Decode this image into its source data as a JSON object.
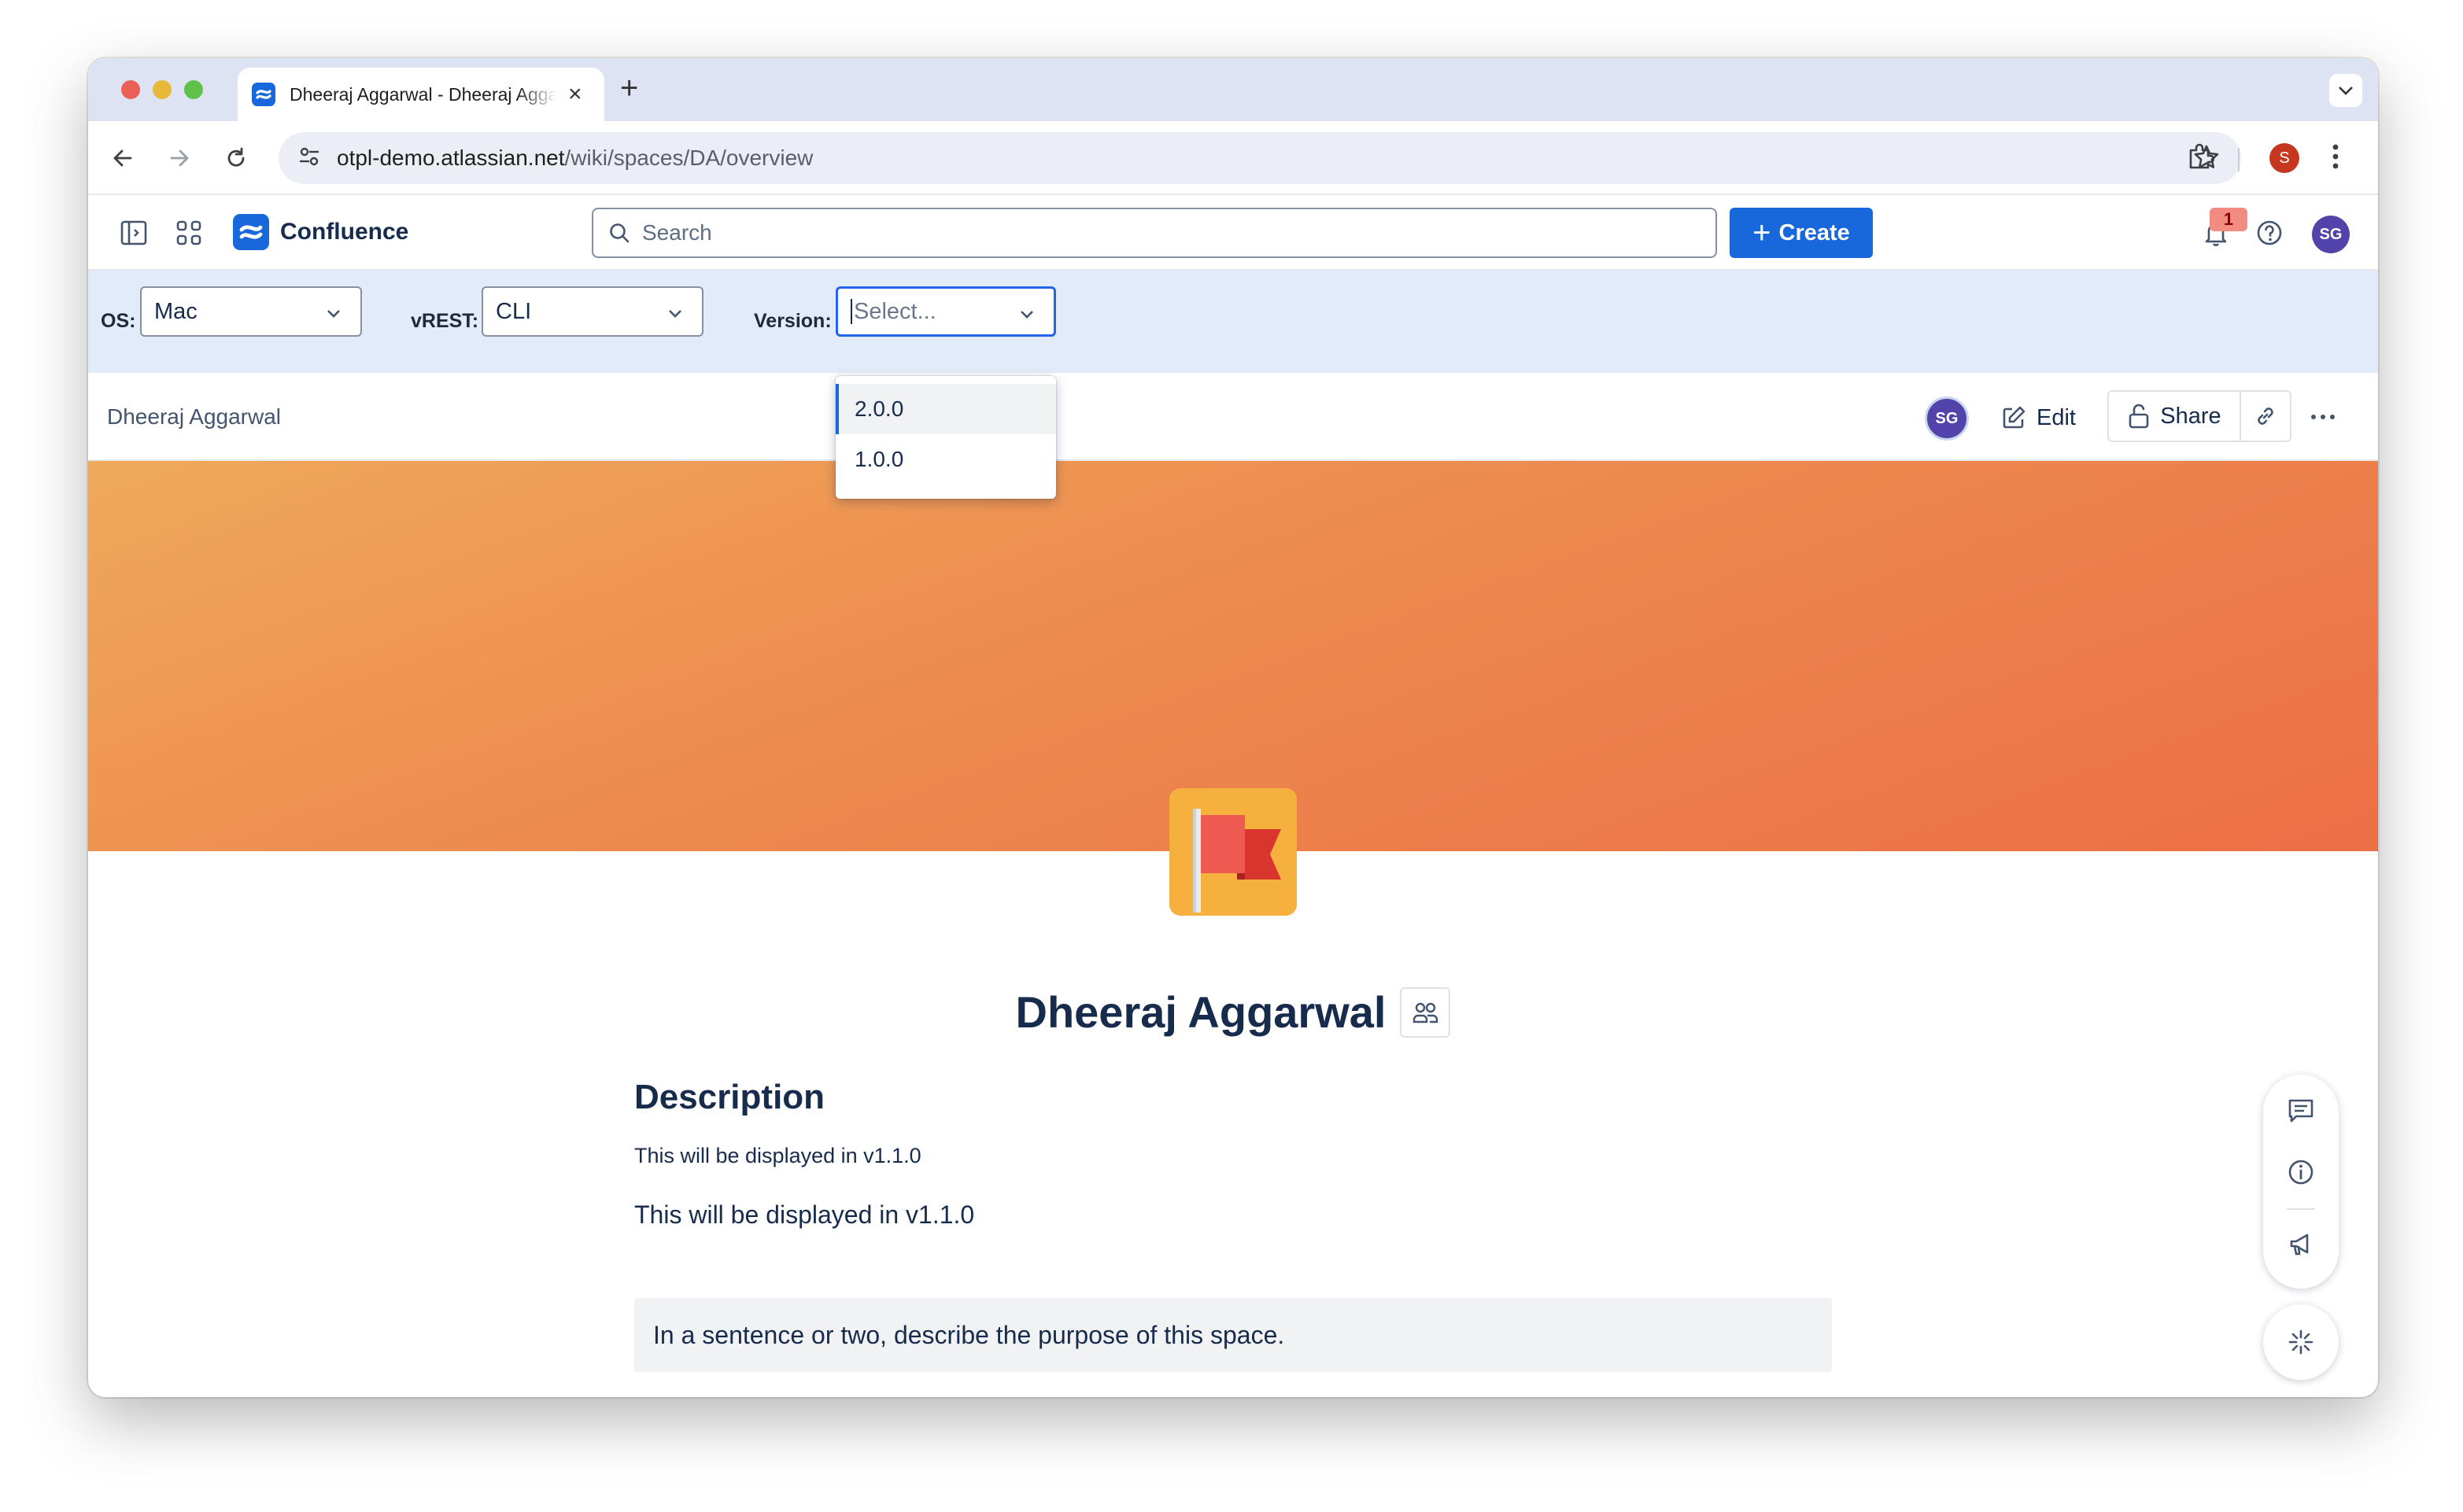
{
  "browser": {
    "tab_title": "Dheeraj Aggarwal - Dheeraj Aggarwal - Confluence",
    "new_tab_symbol": "+",
    "close_symbol": "×",
    "url_host": "otpl-demo.atlassian.net",
    "url_path": "/wiki/spaces/DA/overview",
    "profile_initial": "S"
  },
  "header": {
    "app_name": "Confluence",
    "search_placeholder": "Search",
    "create_label": "Create",
    "notification_count": "1",
    "user_initials": "SG"
  },
  "filters": {
    "os_label": "OS:",
    "os_value": "Mac",
    "vrest_label": "vREST:",
    "vrest_value": "CLI",
    "version_label": "Version:",
    "version_placeholder": "Select...",
    "version_options": [
      "2.0.0",
      "1.0.0"
    ]
  },
  "page_bar": {
    "space_name": "Dheeraj Aggarwal",
    "avatar_initials": "SG",
    "edit_label": "Edit",
    "share_label": "Share"
  },
  "content": {
    "space_title": "Dheeraj Aggarwal",
    "description_heading": "Description",
    "line1": "This will be displayed in v1.1.0",
    "line2": "This will be displayed in v1.1.0",
    "hint": "In a sentence or two, describe the purpose of this space."
  },
  "colors": {
    "brand_blue": "#1868db",
    "banner_start": "#efa95a",
    "banner_end": "#ec6f45",
    "filter_bar_bg": "#e2ebf9",
    "avatar_purple": "#5243aa"
  }
}
